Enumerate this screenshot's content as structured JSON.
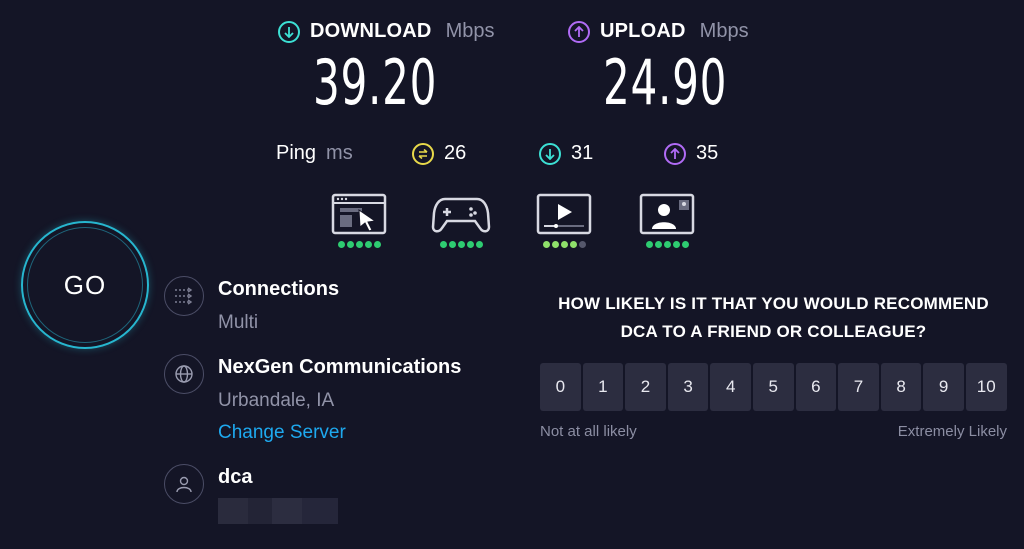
{
  "download": {
    "label": "DOWNLOAD",
    "unit": "Mbps",
    "value": "39.20",
    "color": "#3ce0d4"
  },
  "upload": {
    "label": "UPLOAD",
    "unit": "Mbps",
    "value": "24.90",
    "color": "#b06bf5"
  },
  "ping": {
    "label": "Ping",
    "unit": "ms",
    "idle": {
      "value": "26",
      "icon": "ping-icon",
      "color": "#e8d94a"
    },
    "download": {
      "value": "31",
      "icon": "arrow-down-icon",
      "color": "#3ce0d4"
    },
    "upload": {
      "value": "35",
      "icon": "arrow-up-icon",
      "color": "#b06bf5"
    }
  },
  "activities": [
    {
      "icon": "web-browsing-icon",
      "rating": 5,
      "max": 5
    },
    {
      "icon": "gaming-icon",
      "rating": 5,
      "max": 5
    },
    {
      "icon": "video-streaming-icon",
      "rating": 4,
      "max": 5
    },
    {
      "icon": "video-chat-icon",
      "rating": 5,
      "max": 5
    }
  ],
  "go_button": {
    "label": "GO"
  },
  "connections": {
    "title": "Connections",
    "value": "Multi",
    "icon": "connections-icon"
  },
  "server": {
    "title": "NexGen Communications",
    "location": "Urbandale, IA",
    "change_link": "Change Server",
    "icon": "globe-icon"
  },
  "user": {
    "name": "dca",
    "icon": "user-icon"
  },
  "survey": {
    "question_line1": "HOW LIKELY IS IT THAT YOU WOULD RECOMMEND",
    "question_line2": "DCA TO A FRIEND OR COLLEAGUE?",
    "options": [
      "0",
      "1",
      "2",
      "3",
      "4",
      "5",
      "6",
      "7",
      "8",
      "9",
      "10"
    ],
    "low_label": "Not at all likely",
    "high_label": "Extremely Likely"
  },
  "colors": {
    "background": "#141526",
    "accent": "#27b6cf",
    "rating_on": "#2ecc71",
    "rating_off": "#55576b",
    "link": "#1ea9ef"
  }
}
